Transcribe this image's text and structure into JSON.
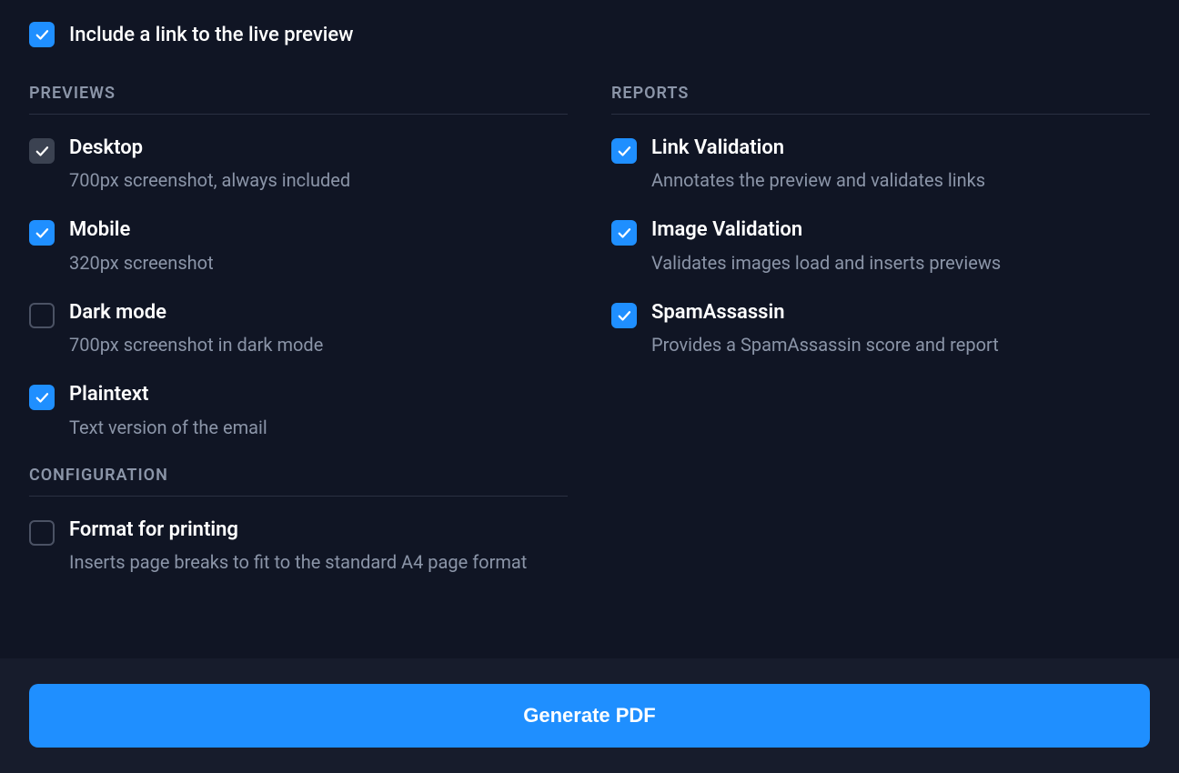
{
  "top": {
    "include_link_label": "Include a link to the live preview"
  },
  "previews": {
    "header": "PREVIEWS",
    "items": [
      {
        "title": "Desktop",
        "desc": "700px screenshot, always included"
      },
      {
        "title": "Mobile",
        "desc": "320px screenshot"
      },
      {
        "title": "Dark mode",
        "desc": "700px screenshot in dark mode"
      },
      {
        "title": "Plaintext",
        "desc": "Text version of the email"
      }
    ]
  },
  "reports": {
    "header": "REPORTS",
    "items": [
      {
        "title": "Link Validation",
        "desc": "Annotates the preview and validates links"
      },
      {
        "title": "Image Validation",
        "desc": "Validates images load and inserts previews"
      },
      {
        "title": "SpamAssassin",
        "desc": "Provides a SpamAssassin score and report"
      }
    ]
  },
  "configuration": {
    "header": "CONFIGURATION",
    "items": [
      {
        "title": "Format for printing",
        "desc": "Inserts page breaks to fit to the standard A4 page format"
      }
    ]
  },
  "footer": {
    "generate_label": "Generate PDF"
  }
}
